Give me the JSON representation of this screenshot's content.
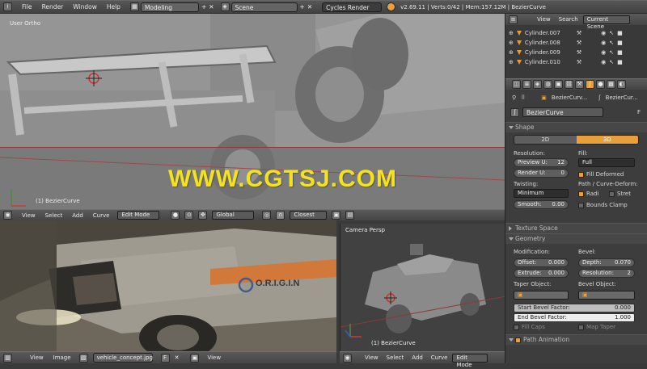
{
  "topbar": {
    "menus": [
      "File",
      "Render",
      "Window",
      "Help"
    ],
    "layout": "Modeling",
    "scene": "Scene",
    "engine": "Cycles Render",
    "stats": "v2.69.11 | Verts:0/42 | Mem:157.12M | BezierCurve"
  },
  "viewport_main": {
    "label": "User Ortho",
    "object_label": "(1) BezierCurve",
    "watermark": "WWW.CGTSJ.COM",
    "header": {
      "view": "View",
      "select": "Select",
      "add": "Add",
      "curve": "Curve",
      "mode": "Edit Mode",
      "orientation": "Global",
      "snap": "Closest"
    }
  },
  "image_editor": {
    "header": {
      "view": "View",
      "image": "Image",
      "image_name": "vehicle_concept.jpg",
      "view2": "View"
    },
    "logo_text": "O.R.I.G.I.N"
  },
  "camera_view": {
    "label": "Camera Persp",
    "object_label": "(1) BezierCurve",
    "header": {
      "view": "View",
      "select": "Select",
      "add": "Add",
      "curve": "Curve",
      "mode": "Edit Mode"
    }
  },
  "outliner": {
    "header": {
      "view": "View",
      "search": "Search",
      "filter": "Current Scene"
    },
    "items": [
      "Cylinder.007",
      "Cylinder.008",
      "Cylinder.009",
      "Cylinder.010"
    ]
  },
  "properties": {
    "breadcrumb": [
      "BezierCurv...",
      "BezierCur..."
    ],
    "datablock": "BezierCurve",
    "datablock_flag": "F",
    "shape": {
      "title": "Shape",
      "tabs": [
        "2D",
        "3D"
      ],
      "resolution_label": "Resolution:",
      "preview_u": {
        "label": "Preview U:",
        "value": "12"
      },
      "render_u": {
        "label": "Render U:",
        "value": "0"
      },
      "fill_label": "Fill:",
      "fill_value": "Full",
      "fill_deformed": "Fill Deformed",
      "twisting_label": "Twisting:",
      "twisting_value": "Minimum",
      "smooth": {
        "label": "Smooth:",
        "value": "0.00"
      },
      "path_label": "Path / Curve-Deform:",
      "radius": "Radi",
      "stretch": "Stret",
      "bounds_clamp": "Bounds Clamp"
    },
    "texture_space": "Texture Space",
    "geometry": {
      "title": "Geometry",
      "modification_label": "Modification:",
      "offset": {
        "label": "Offset:",
        "value": "0.000"
      },
      "extrude": {
        "label": "Extrude:",
        "value": "0.000"
      },
      "bevel_label": "Bevel:",
      "depth": {
        "label": "Depth:",
        "value": "0.070"
      },
      "resolution": {
        "label": "Resolution:",
        "value": "2"
      },
      "taper_label": "Taper Object:",
      "bevel_object_label": "Bevel Object:",
      "start_bevel": {
        "label": "Start Bevel Factor:",
        "value": "0.000"
      },
      "end_bevel": {
        "label": "End Bevel Factor:",
        "value": "1.000"
      },
      "fill_caps": "Fill Caps",
      "map_taper": "Map Taper"
    },
    "path_animation": "Path Animation"
  },
  "colors": {
    "accent": "#e8a03a",
    "watermark": "#f4e21c",
    "bg": "#3a3a3a"
  }
}
